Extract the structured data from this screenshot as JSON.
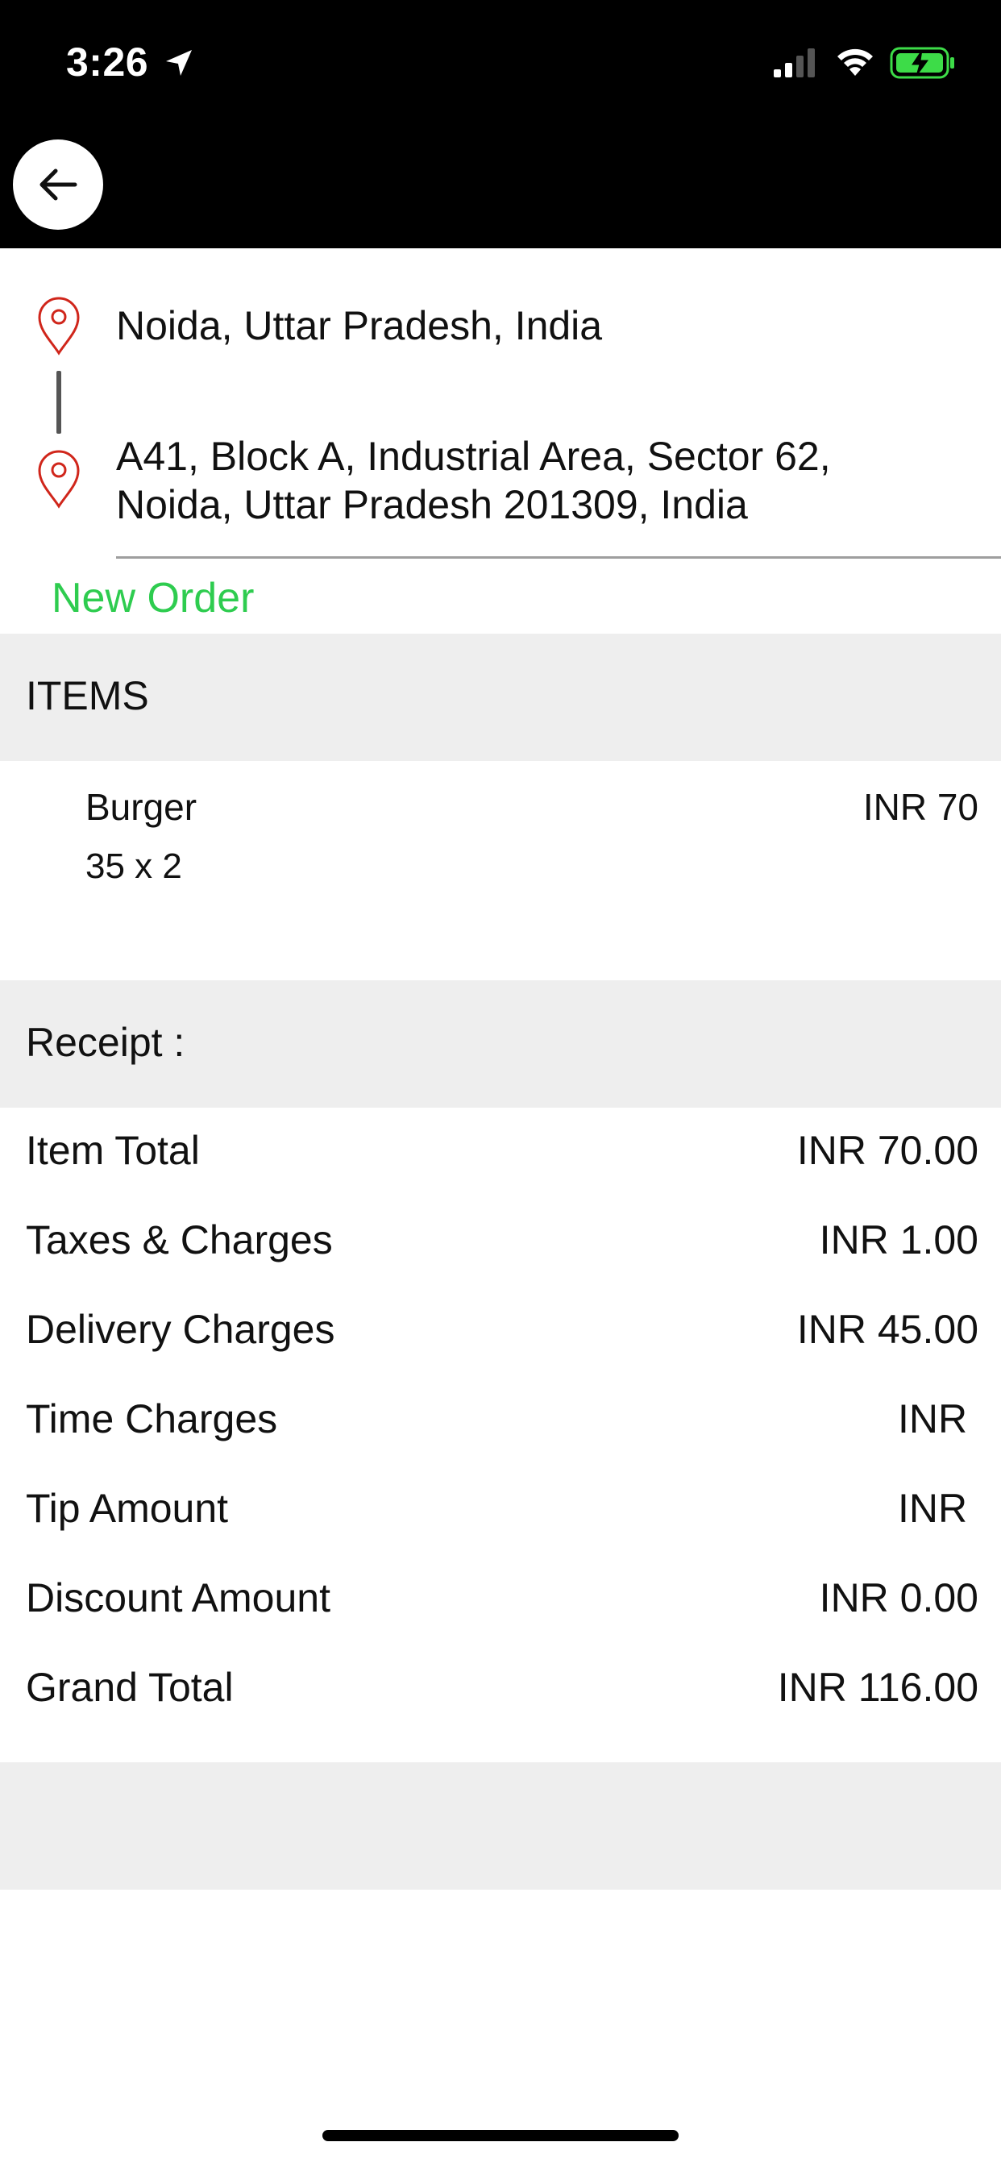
{
  "status_bar": {
    "time": "3:26"
  },
  "header": {
    "back_icon": "arrow-left-icon"
  },
  "route": {
    "pickup": "Noida, Uttar Pradesh, India",
    "dropoff_line1": "A41, Block A, Industrial Area, Sector 62,",
    "dropoff_line2": "Noida, Uttar Pradesh 201309, India",
    "pin_color": "#d0261b"
  },
  "order": {
    "status": "New Order",
    "status_color": "#2ecc4f"
  },
  "items_section": {
    "title": "ITEMS",
    "items": [
      {
        "name": "Burger",
        "qty_line": "35 x 2",
        "price": "INR 70"
      }
    ]
  },
  "receipt": {
    "title": "Receipt :",
    "rows": [
      {
        "label": "Item Total",
        "value": "INR 70.00"
      },
      {
        "label": "Taxes & Charges",
        "value": "INR 1.00"
      },
      {
        "label": "Delivery Charges",
        "value": "INR 45.00"
      },
      {
        "label": "Time Charges",
        "value": "INR "
      },
      {
        "label": "Tip Amount",
        "value": "INR "
      },
      {
        "label": "Discount Amount",
        "value": "INR 0.00"
      },
      {
        "label": "Grand Total",
        "value": "INR 116.00"
      }
    ]
  },
  "colors": {
    "header_bg": "#000000",
    "section_bg": "#eeeeee",
    "battery_green": "#3ddc48"
  }
}
